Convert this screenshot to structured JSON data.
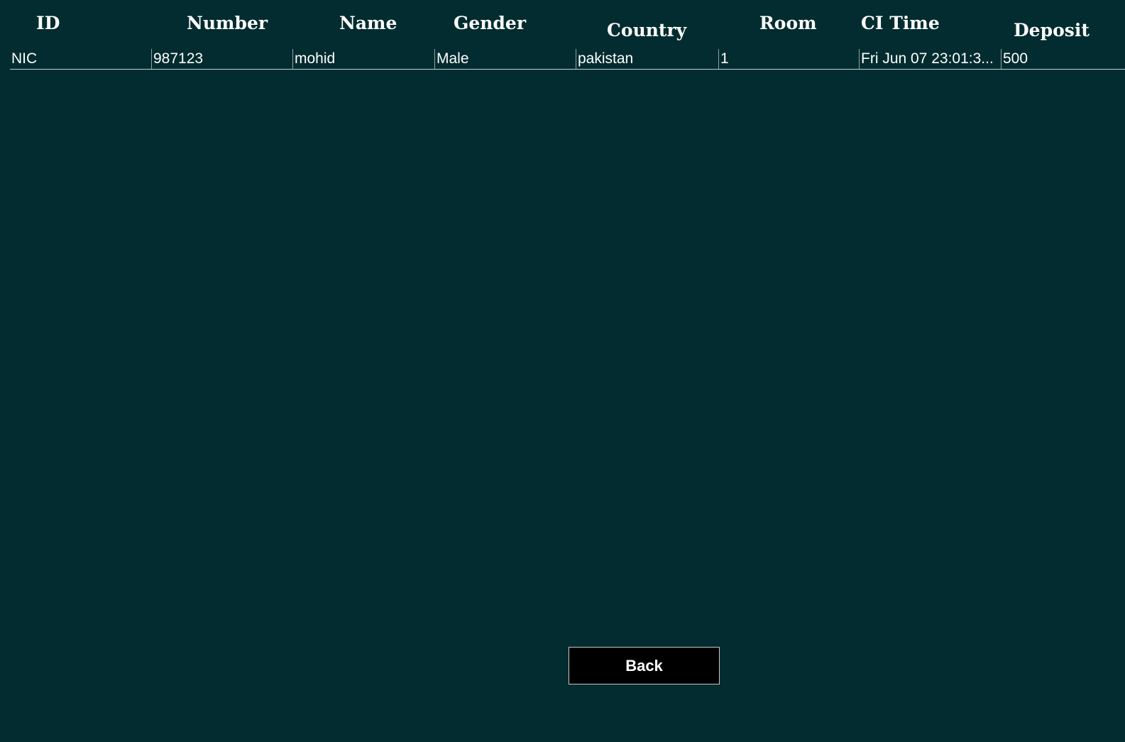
{
  "table": {
    "headers": {
      "id": "ID",
      "number": "Number",
      "name": "Name",
      "gender": "Gender",
      "country": "Country",
      "room": "Room",
      "ci_time": "CI Time",
      "deposit": "Deposit"
    },
    "rows": [
      {
        "id": "NIC",
        "number": "987123",
        "name": "mohid",
        "gender": "Male",
        "country": "pakistan",
        "room": "1",
        "ci_time": "Fri Jun 07 23:01:3...",
        "deposit": "500"
      }
    ]
  },
  "buttons": {
    "back_label": "Back"
  },
  "colors": {
    "background": "#022c2f",
    "button_background": "#000000",
    "text": "#ffffff"
  }
}
